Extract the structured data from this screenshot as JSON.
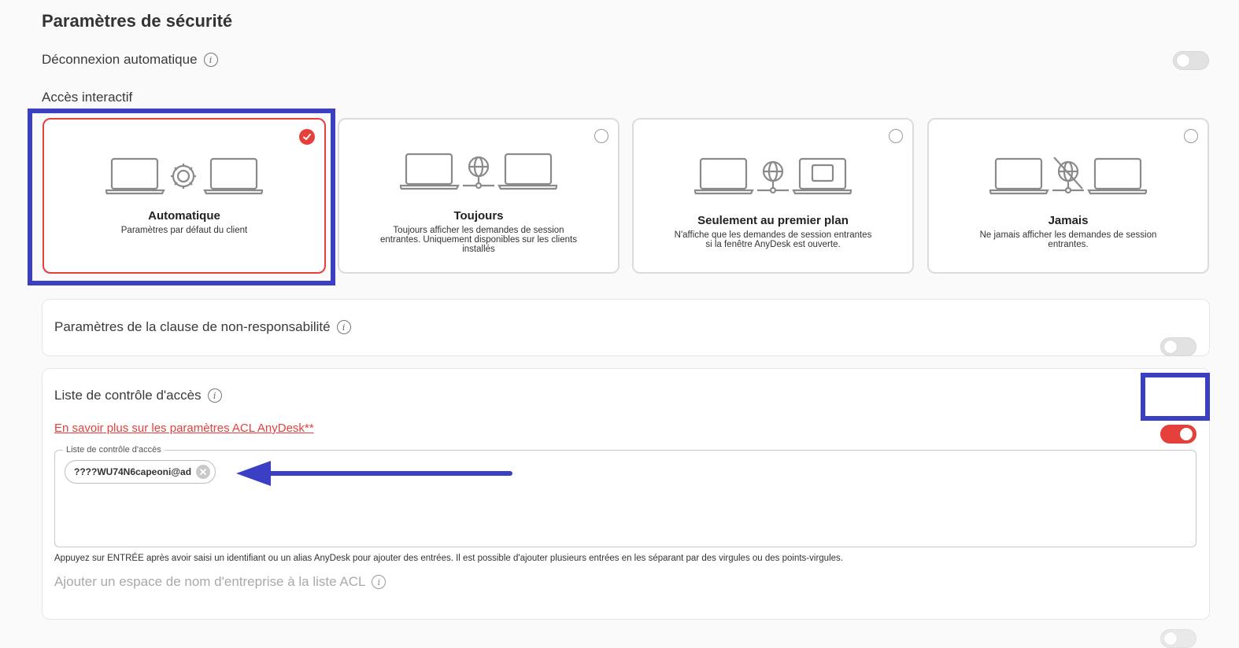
{
  "page": {
    "title": "Paramètres de sécurité"
  },
  "auto_logout": {
    "label": "Déconnexion automatique",
    "enabled": false
  },
  "interactive_access": {
    "label": "Accès interactif",
    "options": [
      {
        "title": "Automatique",
        "description": "Paramètres par défaut du client",
        "selected": true,
        "icon": "laptop-gear-laptop"
      },
      {
        "title": "Toujours",
        "description": "Toujours afficher les demandes de session entrantes. Uniquement disponibles sur les clients installés",
        "selected": false,
        "icon": "laptop-globe-laptop"
      },
      {
        "title": "Seulement au premier plan",
        "description": "N'affiche que les demandes de session entrantes si la fenêtre AnyDesk est ouverte.",
        "selected": false,
        "icon": "laptop-globe-window-laptop"
      },
      {
        "title": "Jamais",
        "description": "Ne jamais afficher les demandes de session entrantes.",
        "selected": false,
        "icon": "laptop-globe-disabled-laptop"
      }
    ]
  },
  "disclaimer": {
    "label": "Paramètres de la clause de non-responsabilité",
    "enabled": false
  },
  "acl": {
    "label": "Liste de contrôle d'accès",
    "enabled": true,
    "link_text": "En savoir plus sur les paramètres ACL AnyDesk**",
    "field_legend": "Liste de contrôle d'accès",
    "entries": [
      "????WU74N6capeoni@ad"
    ],
    "help_text": "Appuyez sur ENTRÉE après avoir saisi un identifiant ou un alias AnyDesk pour ajouter des entrées. Il est possible d'ajouter plusieurs entrées en les séparant par des virgules ou des points-virgules."
  },
  "namespace": {
    "label": "Ajouter un espace de nom d'entreprise à la liste ACL",
    "enabled": false
  },
  "colors": {
    "accent": "#e5403c",
    "annotation": "#3a3fc4"
  }
}
